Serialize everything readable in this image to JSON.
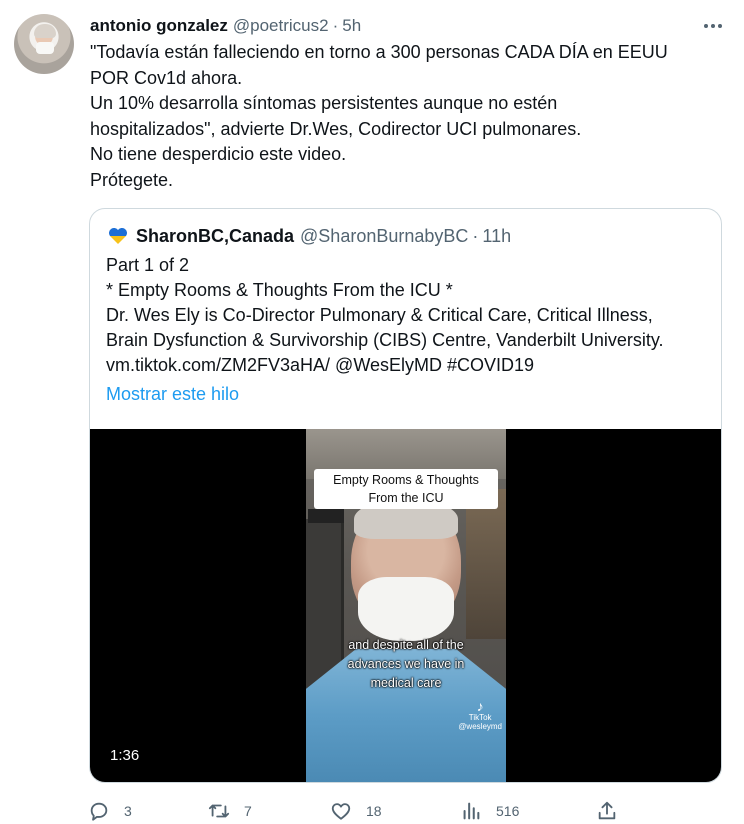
{
  "tweet": {
    "author_name": "antonio gonzalez",
    "author_handle": "@poetricus2",
    "separator": "·",
    "time": "5h",
    "text_lines": [
      "\"Todavía están falleciendo en torno a 300 personas CADA DÍA en EEUU",
      "POR Cov1d ahora.",
      "Un 10% desarrolla síntomas persistentes aunque no estén",
      "hospitalizados\", advierte Dr.Wes, Codirector UCI pulmonares.",
      "No tiene desperdicio este video.",
      "Prótegete."
    ]
  },
  "quote": {
    "author_name": "SharonBC,Canada",
    "author_handle": "@SharonBurnabyBC",
    "separator": "·",
    "time": "11h",
    "text_lines": [
      "Part 1 of 2",
      "* Empty Rooms & Thoughts From the ICU *",
      "Dr. Wes Ely is Co-Director Pulmonary & Critical Care, Critical Illness,",
      "Brain Dysfunction & Survivorship (CIBS) Centre, Vanderbilt University.",
      "vm.tiktok.com/ZM2FV3aHA/ @WesElyMD #COVID19"
    ],
    "show_thread": "Mostrar este hilo",
    "video": {
      "caption_top_lines": [
        "Empty Rooms & Thoughts",
        "From the ICU"
      ],
      "subtitle_lines": [
        "and despite all of the",
        "advances we have in",
        "medical care"
      ],
      "watermark": "TikTok",
      "watermark_user": "@wesleymd",
      "duration": "1:36"
    }
  },
  "actions": {
    "replies": "3",
    "retweets": "7",
    "likes": "18",
    "views": "516"
  },
  "colors": {
    "text": "#0f1419",
    "secondary": "#536471",
    "link": "#1d9bf0",
    "border": "#cfd9de"
  },
  "icons": [
    "more-icon",
    "ukraine-heart-icon",
    "reply-icon",
    "retweet-icon",
    "like-icon",
    "views-icon",
    "share-icon"
  ]
}
